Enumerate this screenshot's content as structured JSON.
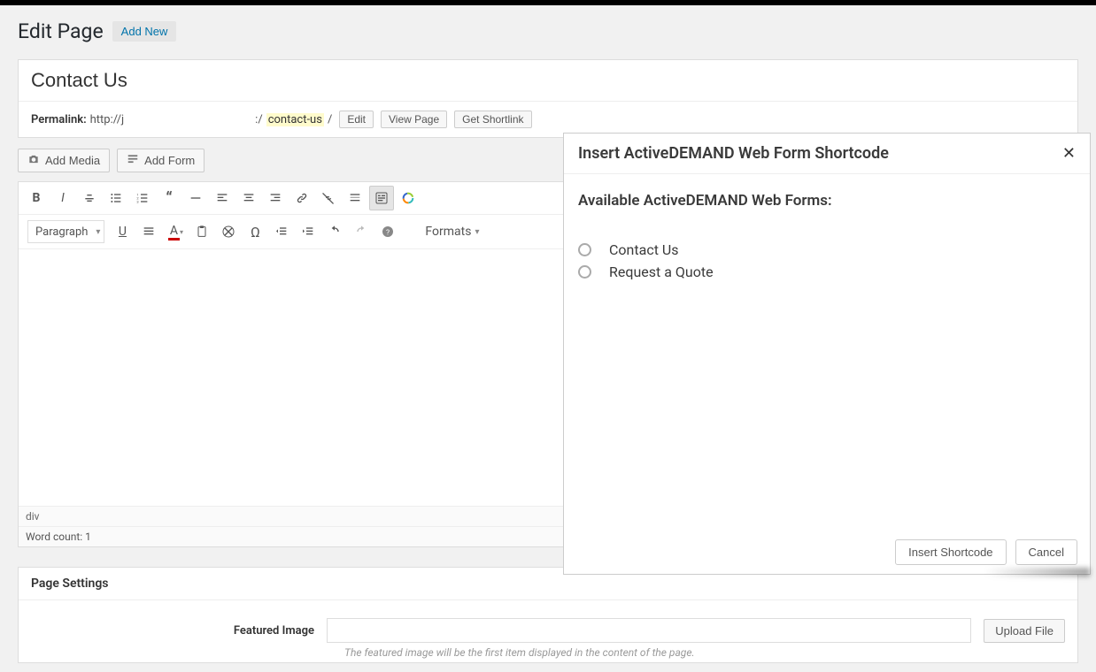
{
  "header": {
    "title": "Edit Page",
    "add_new": "Add New"
  },
  "page": {
    "title_value": "Contact Us",
    "permalink_label": "Permalink:",
    "permalink_prefix": "http://j",
    "permalink_mid": ":/",
    "permalink_slug": "contact-us",
    "permalink_suffix": "/",
    "edit_label": "Edit",
    "view_page_label": "View Page",
    "get_shortlink_label": "Get Shortlink"
  },
  "media": {
    "add_media": "Add Media",
    "add_form": "Add Form"
  },
  "toolbar": {
    "paragraph": "Paragraph",
    "formats": "Formats"
  },
  "editor": {
    "path": "div",
    "wordcount": "Word count: 1"
  },
  "settings": {
    "panel_title": "Page Settings",
    "featured_label": "Featured Image",
    "featured_value": "",
    "upload_label": "Upload File",
    "featured_help": "The featured image will be the first item displayed in the content of the page."
  },
  "modal": {
    "title": "Insert ActiveDEMAND Web Form Shortcode",
    "subtitle": "Available ActiveDEMAND Web Forms:",
    "options": [
      "Contact Us",
      "Request a Quote"
    ],
    "insert_label": "Insert Shortcode",
    "cancel_label": "Cancel"
  }
}
